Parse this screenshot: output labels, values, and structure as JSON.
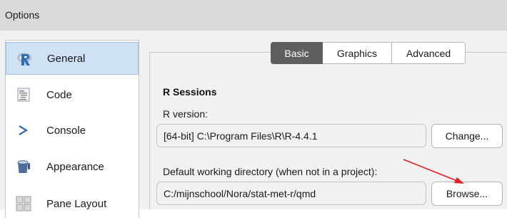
{
  "window": {
    "title": "Options"
  },
  "sidebar": {
    "items": [
      {
        "label": "General",
        "icon": "r-logo-icon",
        "selected": true
      },
      {
        "label": "Code",
        "icon": "code-icon",
        "selected": false
      },
      {
        "label": "Console",
        "icon": "console-prompt-icon",
        "selected": false
      },
      {
        "label": "Appearance",
        "icon": "paint-bucket-icon",
        "selected": false
      },
      {
        "label": "Pane Layout",
        "icon": "pane-layout-icon",
        "selected": false
      }
    ]
  },
  "tabs": [
    {
      "label": "Basic",
      "active": true
    },
    {
      "label": "Graphics",
      "active": false
    },
    {
      "label": "Advanced",
      "active": false
    }
  ],
  "r_sessions": {
    "section_title": "R Sessions",
    "r_version_label": "R version:",
    "r_version_value": "[64-bit] C:\\Program Files\\R\\R-4.4.1",
    "change_button": "Change...",
    "working_dir_label": "Default working directory (when not in a project):",
    "working_dir_value": "C:/mijnschool/Nora/stat-met-r/qmd",
    "browse_button": "Browse..."
  },
  "colors": {
    "selected_item_bg": "#cfe1f5",
    "active_tab_bg": "#5e5e5e",
    "annotation_arrow": "#e02020"
  }
}
